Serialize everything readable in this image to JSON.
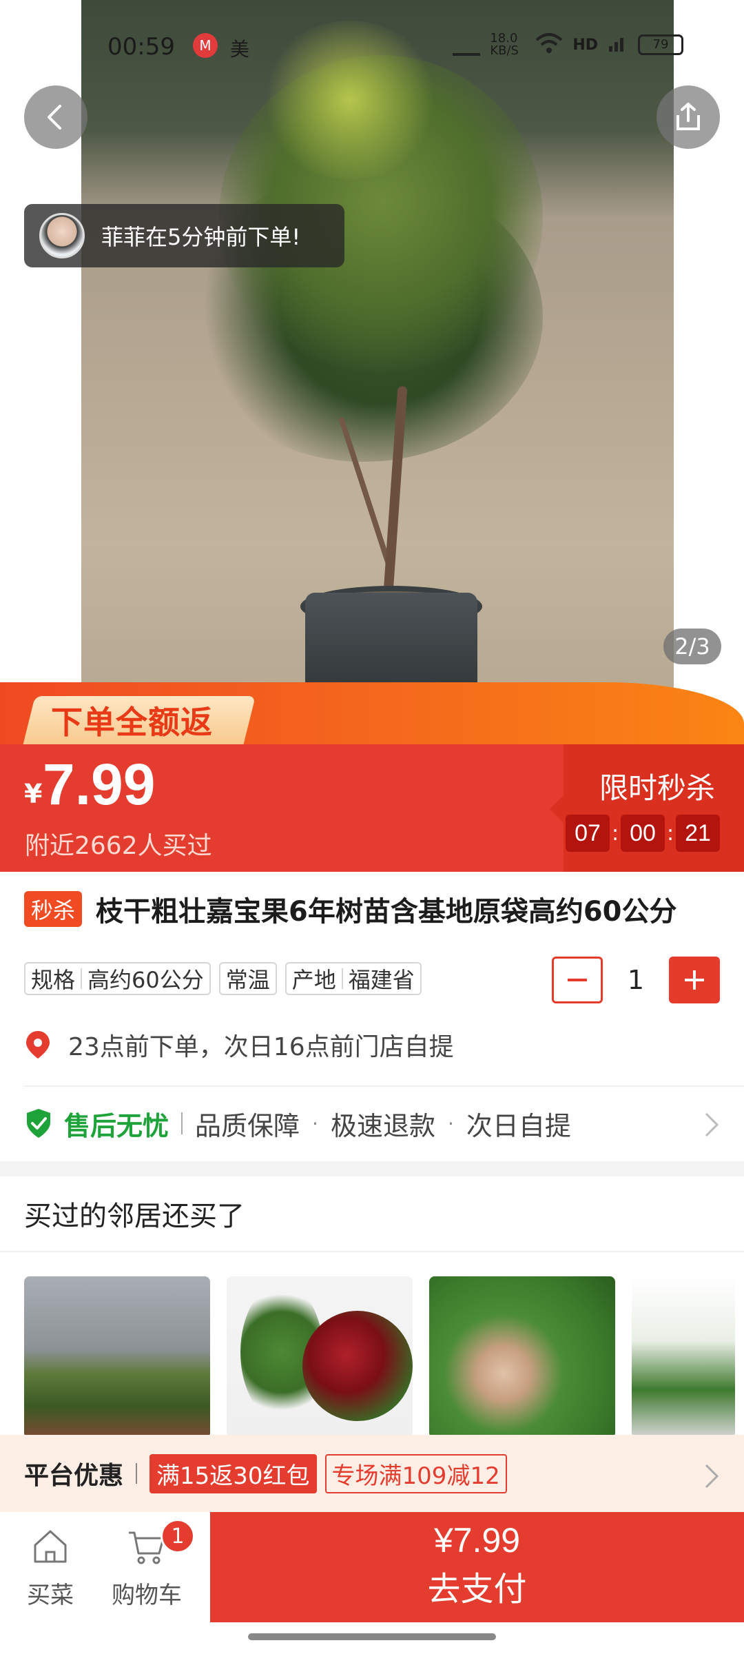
{
  "status_bar": {
    "time": "00:59",
    "app_icon_letter": "M",
    "app_icon2": "美",
    "network_speed": "18.0 KB/S",
    "battery": "79"
  },
  "hero": {
    "toast": "菲菲在5分钟前下单!",
    "page_indicator": "2/3"
  },
  "promo": {
    "tag": "下单全额返"
  },
  "price": {
    "currency": "¥",
    "value": "7.99",
    "sold_info": "附近2662人买过",
    "flash_title": "限时秒杀",
    "countdown": [
      "07",
      "00",
      "21"
    ]
  },
  "product": {
    "badge": "秒杀",
    "title": "枝干粗壮嘉宝果6年树苗含基地原袋高约60公分"
  },
  "specs": [
    {
      "label": "规格",
      "value": "高约60公分"
    },
    {
      "label": "常温",
      "value": ""
    },
    {
      "label": "产地",
      "value": "福建省"
    }
  ],
  "quantity": "1",
  "pickup": "23点前下单，次日16点前门店自提",
  "service": {
    "title": "售后无忧",
    "items": [
      "品质保障",
      "极速退款",
      "次日自提"
    ]
  },
  "recommend": {
    "title": "买过的邻居还买了"
  },
  "platform": {
    "title": "平台优惠",
    "coupon1": "满15返30红包",
    "coupon2": "专场满109减12"
  },
  "bottom": {
    "tab_shop": "买菜",
    "tab_cart": "购物车",
    "cart_count": "1",
    "pay_price": "¥7.99",
    "pay_label": "去支付"
  },
  "colors": {
    "accent_red": "#e43d2f",
    "service_green": "#1ea33a",
    "promo_orange": "#f56a1c"
  }
}
